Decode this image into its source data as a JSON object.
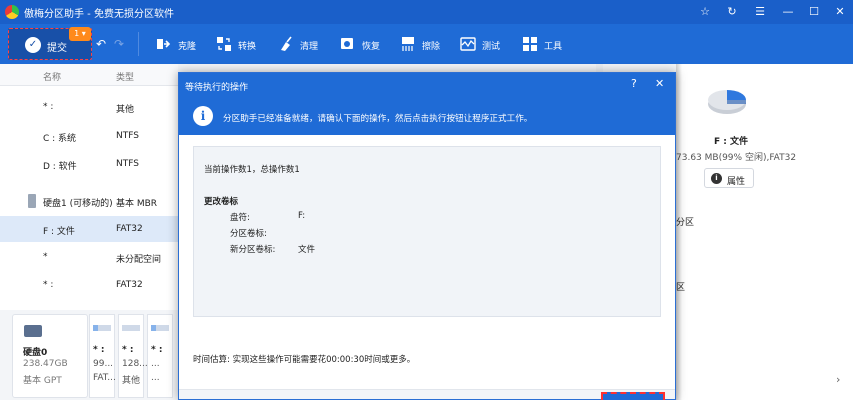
{
  "window": {
    "title": "傲梅分区助手 - 免费无损分区软件",
    "controls": [
      "☆",
      "↻",
      "☰",
      "—",
      "☐",
      "✕"
    ]
  },
  "toolbar": {
    "commit_label": "提交",
    "commit_count": "1",
    "tools": [
      {
        "label": "克隆",
        "icon": "clone-icon"
      },
      {
        "label": "转换",
        "icon": "convert-icon"
      },
      {
        "label": "清理",
        "icon": "clean-icon"
      },
      {
        "label": "恢复",
        "icon": "recover-icon"
      },
      {
        "label": "擦除",
        "icon": "wipe-icon"
      },
      {
        "label": "测试",
        "icon": "test-icon"
      },
      {
        "label": "工具",
        "icon": "tools-icon"
      }
    ]
  },
  "partition_list": {
    "headers": {
      "name": "名称",
      "type": "类型"
    },
    "rows": [
      {
        "name": "* :",
        "type": "其他"
      },
      {
        "name": "C : 系统",
        "type": "NTFS"
      },
      {
        "name": "D : 软件",
        "type": "NTFS"
      },
      {
        "name": "硬盘1 (可移动的)",
        "type": "基本 MBR"
      },
      {
        "name": "F : 文件",
        "type": "FAT32"
      },
      {
        "name": "*",
        "type": "未分配空间"
      },
      {
        "name": "* :",
        "type": "FAT32"
      }
    ]
  },
  "disk_map": {
    "disk_name": "硬盘0",
    "disk_size": "238.47GB",
    "disk_type": "基本 GPT",
    "partitions": [
      {
        "letter": "* :",
        "size": "99...",
        "fs": "FAT..."
      },
      {
        "letter": "* :",
        "size": "128...",
        "fs": "其他"
      },
      {
        "letter": "* :",
        "size": "...",
        "fs": "..."
      }
    ]
  },
  "dialog": {
    "title": "等待执行的操作",
    "help": "?",
    "close": "✕",
    "info_icon": "i",
    "info_text": "分区助手已经准备就绪，请确认下面的操作，然后点击执行按钮让程序正式工作。",
    "ops_summary": "当前操作数1，总操作数1",
    "op_title": "更改卷标",
    "op_fields": [
      {
        "label": "盘符:",
        "value": "F:"
      },
      {
        "label": "分区卷标:",
        "value": ""
      },
      {
        "label": "新分区卷标:",
        "value": "文件"
      }
    ],
    "estimate": "时间估算: 实现这些操作可能需要花00:00:30时间或更多。"
  },
  "right_panel": {
    "partition_name": "F : 文件",
    "capacity": "73.63 MB(99% 空闲),FAT32",
    "properties_label": "属性",
    "item1": "分区",
    "item2": "区",
    "next_arrow": "›"
  },
  "colors": {
    "title_bar": "#1a5fc9",
    "toolbar": "#1f6bd6",
    "commit_button": "#1850a8",
    "badge": "#ff8a1c",
    "highlight_dashed": "#ff3030",
    "selected_row": "#dde9f9"
  }
}
